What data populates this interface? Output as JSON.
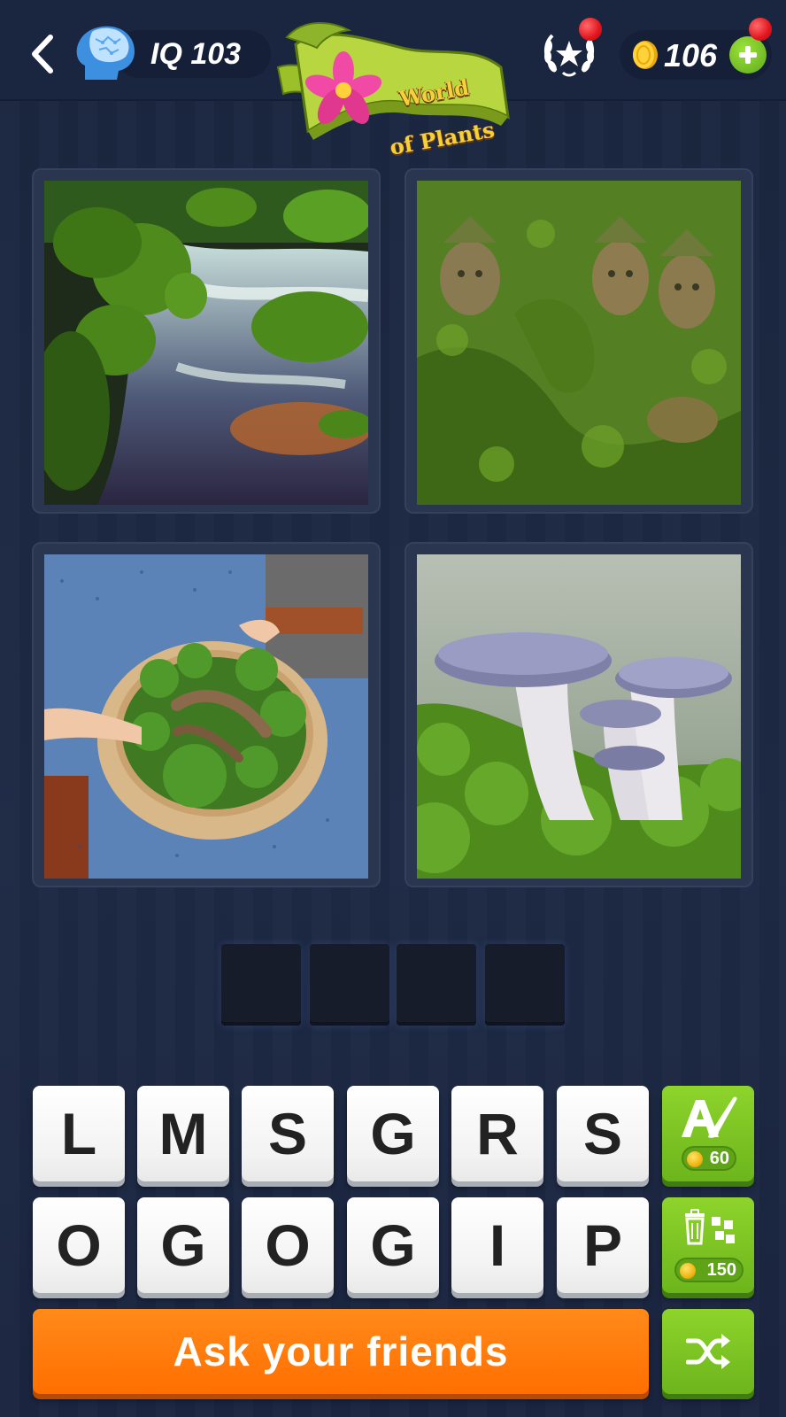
{
  "header": {
    "iq_label": "IQ 103",
    "banner_line1": "World",
    "banner_line2": "of Plants",
    "coins": "106"
  },
  "photos": [
    {
      "name": "mossy-stream-photo"
    },
    {
      "name": "moss-covered-statues-photo"
    },
    {
      "name": "moss-bowl-photo"
    },
    {
      "name": "mushrooms-on-moss-photo"
    }
  ],
  "answer": {
    "slot_count": 4
  },
  "letters": {
    "row1": [
      "L",
      "M",
      "S",
      "G",
      "R",
      "S"
    ],
    "row2": [
      "O",
      "G",
      "O",
      "G",
      "I",
      "P"
    ]
  },
  "hints": {
    "reveal_letter_price": "60",
    "remove_letters_price": "150"
  },
  "ask_button": "Ask your friends",
  "colors": {
    "background": "#1d2841",
    "accent_orange": "#ff7a00",
    "accent_green": "#7cc61f"
  }
}
